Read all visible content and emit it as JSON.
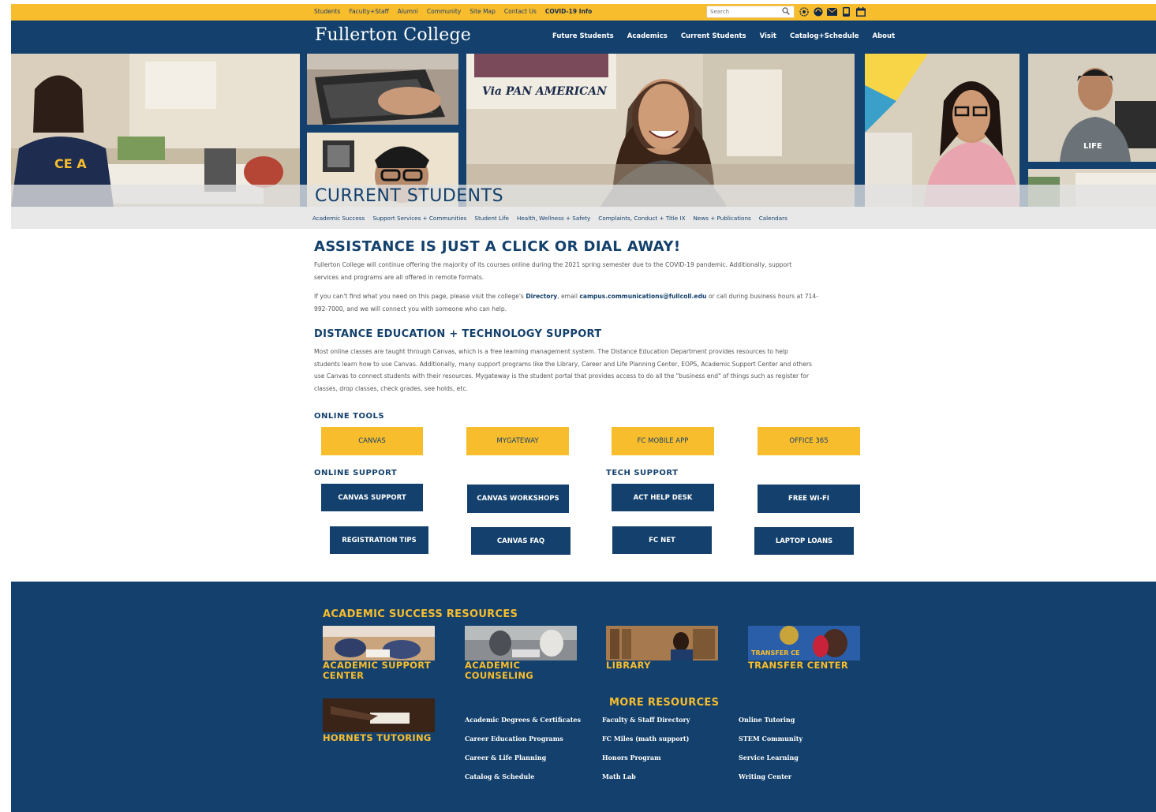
{
  "utility_bar": {
    "links": [
      "Students",
      "Faculty+Staff",
      "Alumni",
      "Community",
      "Site Map",
      "Contact Us"
    ],
    "covid_link": "COVID-19 Info",
    "search_placeholder": "Search",
    "icons": [
      "search-icon",
      "accessibility-icon",
      "translate-icon",
      "mail-icon",
      "phone-icon",
      "calendar-icon"
    ]
  },
  "header": {
    "logo": "Fullerton College",
    "nav": [
      "Future Students",
      "Academics",
      "Current Students",
      "Visit",
      "Catalog+Schedule",
      "About"
    ]
  },
  "hero": {
    "title": "CURRENT STUDENTS",
    "poster_text": "Via PAN AMERICAN"
  },
  "subnav": [
    "Academic Success",
    "Support Services + Communities",
    "Student Life",
    "Health, Wellness + Safety",
    "Complaints, Conduct + Title IX",
    "News + Publications",
    "Calendars"
  ],
  "main": {
    "headline": "ASSISTANCE IS JUST A CLICK OR DIAL AWAY!",
    "intro_line1": "Fullerton College will continue offering the majority of its courses online during the 2021 spring semester due to the COVID-19 pandemic. Additionally, support",
    "intro_line2": "services and programs are all offered in remote formats.",
    "contact_pre": "If you can't find what you need on this page, please visit the college's ",
    "contact_directory": "Directory",
    "contact_mid": ", email ",
    "contact_email": "campus.communications@fullcoll.edu",
    "contact_post": " or call during business hours at 714-",
    "contact_line2": "992-7000, and we will connect you with someone who can help.",
    "distance_heading": "DISTANCE EDUCATION + TECHNOLOGY SUPPORT",
    "distance_lines": [
      "Most online classes are taught through Canvas, which is a free learning management system. The Distance Education Department provides resources to help",
      "students learn how to use Canvas. Additionally, many support programs like the Library, Career and Life Planning Center, EOPS, Academic Support Center and others",
      "use Canvas to connect students with their resources. Mygateway is the student portal that provides access to do all the \"business end\" of things such as register for",
      "classes, drop classes, check grades, see holds, etc."
    ],
    "online_tools_label": "ONLINE TOOLS",
    "online_tools": [
      "CANVAS",
      "MYGATEWAY",
      "FC MOBILE APP",
      "OFFICE 365"
    ],
    "online_support_label": "ONLINE SUPPORT",
    "tech_support_label": "TECH SUPPORT",
    "support_row1": [
      "CANVAS SUPPORT",
      "CANVAS WORKSHOPS",
      "ACT HELP DESK",
      "FREE WI-FI"
    ],
    "support_row2": [
      "REGISTRATION TIPS",
      "CANVAS FAQ",
      "FC NET",
      "LAPTOP LOANS"
    ]
  },
  "footer": {
    "academic_title": "ACADEMIC SUCCESS RESOURCES",
    "cards": [
      {
        "line1": "ACADEMIC SUPPORT",
        "line2": "CENTER"
      },
      {
        "line1": "ACADEMIC",
        "line2": "COUNSELING"
      },
      {
        "line1": "LIBRARY",
        "line2": ""
      },
      {
        "line1": "TRANSFER CENTER",
        "line2": ""
      },
      {
        "line1": "HORNETS TUTORING",
        "line2": ""
      }
    ],
    "transfer_img_text": "TRANSFER CE",
    "more_title": "MORE RESOURCES",
    "more_col1": [
      "Academic Degrees & Certificates",
      "Career Education Programs",
      "Career & Life Planning",
      "Catalog & Schedule"
    ],
    "more_col2": [
      "Faculty & Staff Directory",
      "FC Miles (math support)",
      "Honors Program",
      "Math Lab"
    ],
    "more_col3": [
      "Online Tutoring",
      "STEM Community",
      "Service Learning",
      "Writing Center"
    ]
  },
  "colors": {
    "gold": "#f8bd2d",
    "navy": "#13406c",
    "light_gray": "#e8e8e8"
  }
}
